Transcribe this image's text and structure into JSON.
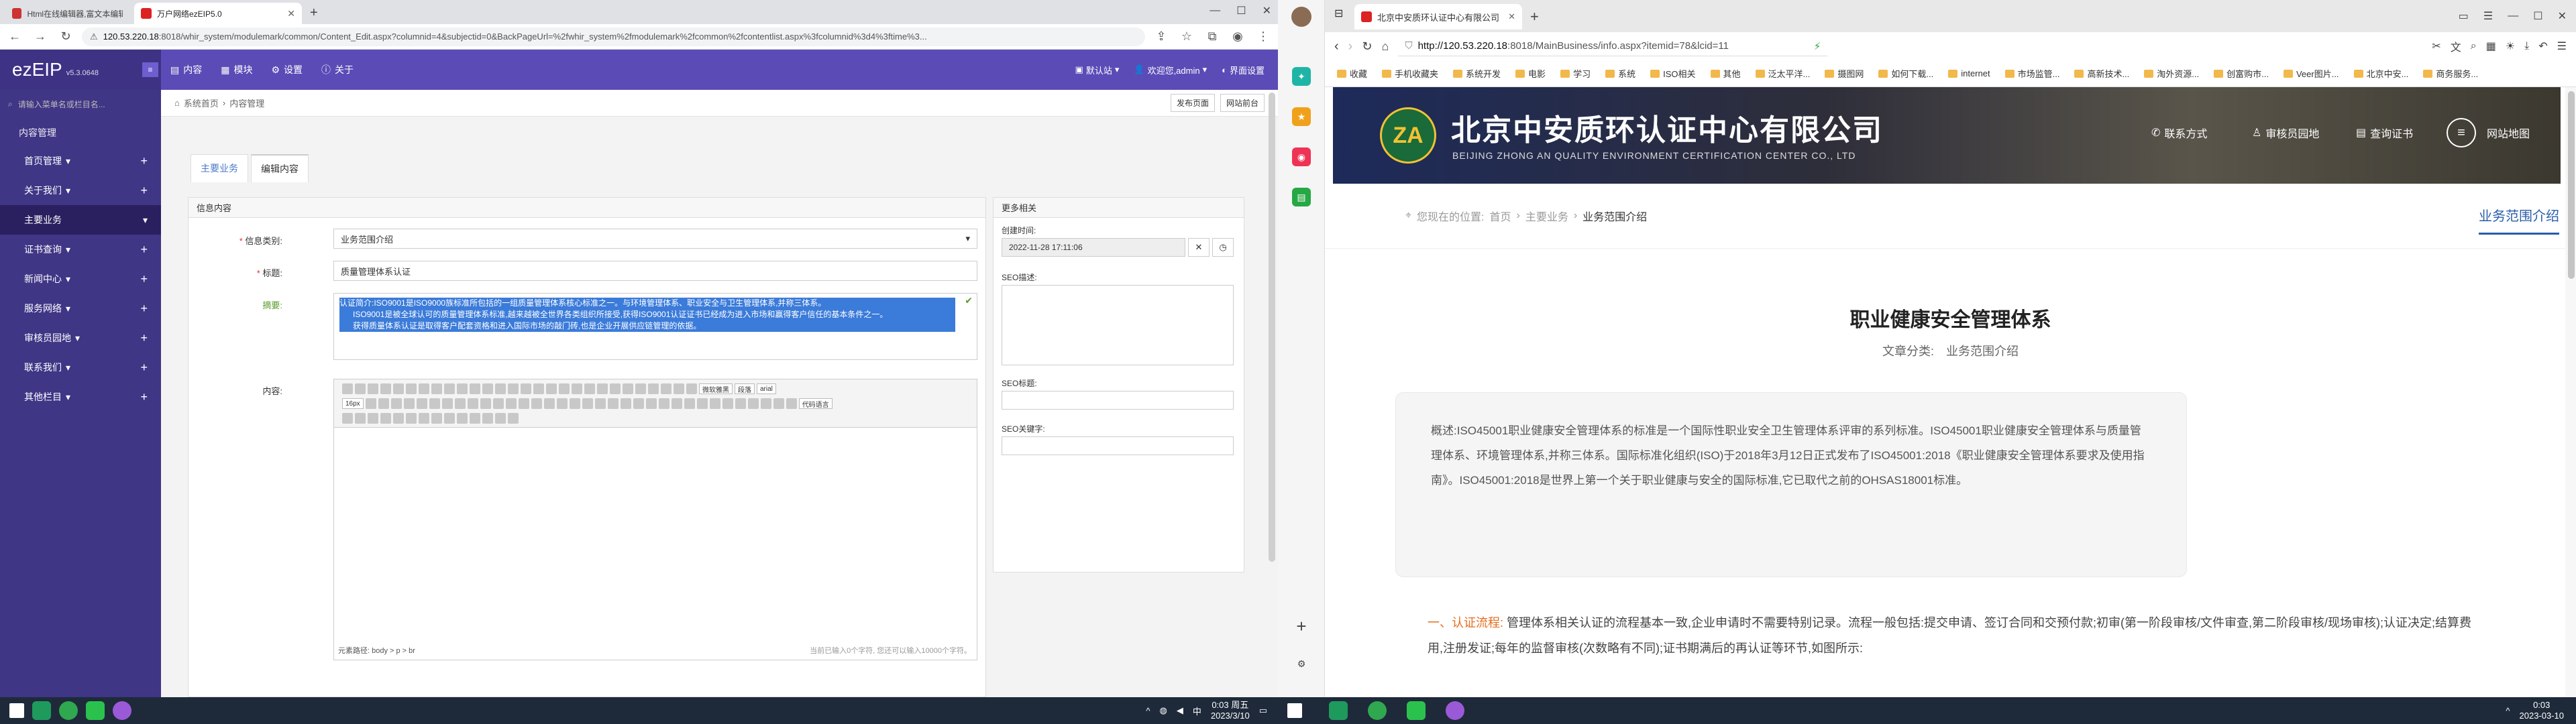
{
  "left_browser": {
    "tabs": [
      {
        "title": "Html在线编辑器,富文本编辑...",
        "active": false
      },
      {
        "title": "万户网络ezEIP5.0",
        "active": true
      }
    ],
    "url_host": "120.53.220.18",
    "url_rest": ":8018/whir_system/modulemark/common/Content_Edit.aspx?columnid=4&subjectid=0&BackPageUrl=%2fwhir_system%2fmodulemark%2fcommon%2fcontentlist.aspx%3fcolumnid%3d4%3ftime%3...",
    "app": {
      "logo": "ezEIP",
      "version": "v5.3.0648",
      "top_nav": [
        "内容",
        "模块",
        "设置",
        "关于"
      ],
      "top_right": [
        "默认站",
        "欢迎您,admin",
        "界面设置"
      ],
      "search_placeholder": "请输入菜单名或栏目名...",
      "sidebar": [
        {
          "label": "内容管理",
          "header": true
        },
        {
          "label": "首页管理",
          "plus": true
        },
        {
          "label": "关于我们",
          "plus": true
        },
        {
          "label": "主要业务",
          "active": true
        },
        {
          "label": "证书查询",
          "plus": true
        },
        {
          "label": "新闻中心",
          "plus": true
        },
        {
          "label": "服务网络",
          "plus": true
        },
        {
          "label": "审核员园地",
          "plus": true
        },
        {
          "label": "联系我们",
          "plus": true
        },
        {
          "label": "其他栏目",
          "plus": true
        }
      ],
      "breadcrumb": [
        "系统首页",
        "内容管理"
      ],
      "header_buttons": [
        "发布页面",
        "网站前台"
      ],
      "tabs": [
        "主要业务",
        "编辑内容"
      ],
      "content_panel": {
        "title": "信息内容",
        "fields": {
          "category_label": "信息类别:",
          "category_value": "业务范围介绍",
          "title_label": "标题:",
          "title_value": "质量管理体系认证",
          "summary_label": "摘要:",
          "summary_lines": [
            "认证简介:ISO9001是ISO9000族标准所包括的一组质量管理体系核心标准之一。与环境管理体系、职业安全与卫生管理体系,并称三体系。",
            "ISO9001是被全球认可的质量管理体系标准,越来越被全世界各类组织所接受,获得ISO9001认证证书已经成为进入市场和赢得客户信任的基本条件之一。",
            "获得质量体系认证是取得客户配套资格和进入国际市场的敲门砖,也是企业开展供应链管理的依据。"
          ],
          "content_label": "内容:",
          "editor_fonts": [
            "微软雅黑",
            "段落",
            "arial"
          ],
          "editor_size": "16px",
          "editor_style": "代码语言",
          "editor_path": "元素路径: body > p > br",
          "editor_count": "当前已输入0个字符, 您还可以输入10000个字符。"
        }
      },
      "side_panel": {
        "title": "更多相关",
        "created_label": "创建时间:",
        "created_value": "2022-11-28 17:11:06",
        "seo_desc_label": "SEO描述:",
        "seo_title_label": "SEO标题:",
        "seo_keywords_label": "SEO关键字:"
      }
    }
  },
  "right_browser": {
    "tabs": [
      {
        "title": "北京中安质环认证中心有限公司",
        "active": true
      }
    ],
    "url_host": "http://120.53.220.18",
    "url_rest": ":8018/MainBusiness/info.aspx?itemid=78&lcid=11",
    "bookmarks": [
      "收藏",
      "手机收藏夹",
      "系统开发",
      "电影",
      "学习",
      "系统",
      "ISO相关",
      "其他",
      "泛太平洋...",
      "摄图网",
      "如何下载...",
      "internet",
      "市场监管...",
      "高新技术...",
      "淘外资源...",
      "创富购市...",
      "Veer图片...",
      "北京中安...",
      "商务服务..."
    ],
    "site": {
      "company_cn": "北京中安质环认证中心有限公司",
      "company_en": "BEIJING ZHONG AN QUALITY ENVIRONMENT CERTIFICATION CENTER CO., LTD",
      "logo_text": "ZA",
      "nav": [
        "联系方式",
        "审核员园地",
        "查询证书"
      ],
      "menu": "网站地图",
      "breadcrumb_prefix": "您现在的位置:",
      "breadcrumb": [
        "首页",
        "主要业务",
        "业务范围介绍"
      ],
      "section_tab": "业务范围介绍",
      "article_title": "职业健康安全管理体系",
      "article_meta_label": "文章分类:",
      "article_meta_value": "业务范围介绍",
      "summary": "概述:ISO45001职业健康安全管理体系的标准是一个国际性职业安全卫生管理体系评审的系列标准。ISO45001职业健康安全管理体系与质量管理体系、环境管理体系,并称三体系。国际标准化组织(ISO)于2018年3月12日正式发布了ISO45001:2018《职业健康安全管理体系要求及使用指南》。ISO45001:2018是世界上第一个关于职业健康与安全的国际标准,它已取代之前的OHSAS18001标准。",
      "step_num": "一、",
      "step_title": "认证流程:",
      "step_text": "管理体系相关认证的流程基本一致,企业申请时不需要特别记录。流程一般包括:提交申请、签订合同和交预付款;初审(第一阶段审核/文件审查,第二阶段审核/现场审核);认证决定;结算费用,注册发证;每年的监督审核(次数略有不同);证书期满后的再认证等环节,如图所示:"
    }
  },
  "taskbar_left": {
    "time": "0:03 周五",
    "date": "2023/3/10"
  },
  "taskbar_right": {
    "time": "0:03",
    "date": "2023-03-10"
  }
}
